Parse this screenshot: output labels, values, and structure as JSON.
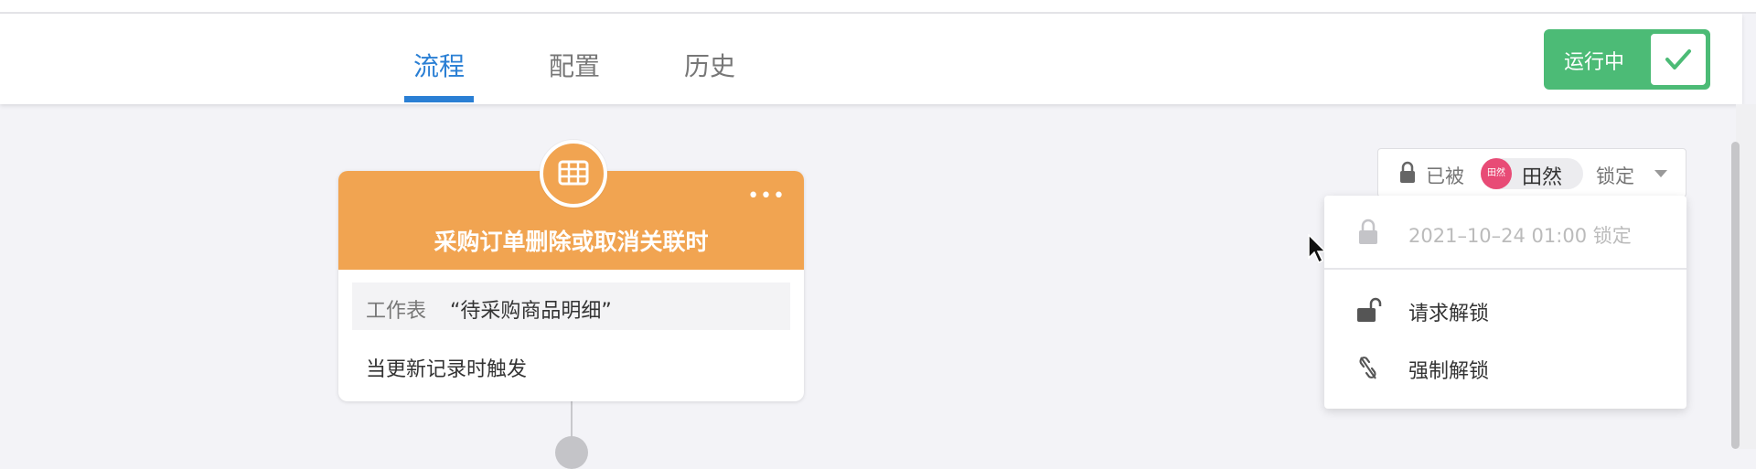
{
  "tabs": [
    {
      "label": "流程",
      "active": true
    },
    {
      "label": "配置",
      "active": false
    },
    {
      "label": "历史",
      "active": false
    }
  ],
  "status": {
    "label": "运行中",
    "color": "#4cbb76",
    "icon": "check-icon"
  },
  "node": {
    "title": "采购订单删除或取消关联时",
    "more_label": "•••",
    "sheet_prefix": "工作表",
    "sheet_name": "“待采购商品明细”",
    "trigger": "当更新记录时触发",
    "icon": "table-icon",
    "color": "#f1a451"
  },
  "lock": {
    "prefix": "已被",
    "avatar_text": "田然",
    "user": "田然",
    "suffix": "锁定",
    "avatar_color": "#e84b76"
  },
  "dropdown": {
    "locked_time": "2021–10–24 01:00 锁定",
    "items": [
      {
        "label": "请求解锁",
        "icon": "unlock-icon"
      },
      {
        "label": "强制解锁",
        "icon": "broken-link-icon"
      }
    ]
  },
  "accent": "#2a7fd4"
}
